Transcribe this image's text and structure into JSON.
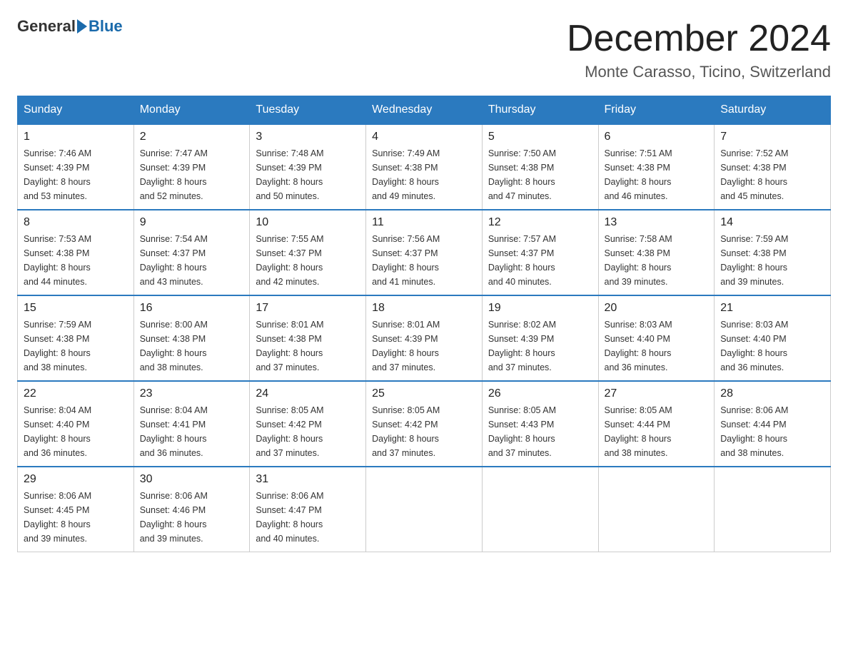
{
  "header": {
    "logo_general": "General",
    "logo_blue": "Blue",
    "month_title": "December 2024",
    "location": "Monte Carasso, Ticino, Switzerland"
  },
  "days_of_week": [
    "Sunday",
    "Monday",
    "Tuesday",
    "Wednesday",
    "Thursday",
    "Friday",
    "Saturday"
  ],
  "weeks": [
    [
      {
        "day": "1",
        "sunrise": "7:46 AM",
        "sunset": "4:39 PM",
        "daylight": "8 hours and 53 minutes."
      },
      {
        "day": "2",
        "sunrise": "7:47 AM",
        "sunset": "4:39 PM",
        "daylight": "8 hours and 52 minutes."
      },
      {
        "day": "3",
        "sunrise": "7:48 AM",
        "sunset": "4:39 PM",
        "daylight": "8 hours and 50 minutes."
      },
      {
        "day": "4",
        "sunrise": "7:49 AM",
        "sunset": "4:38 PM",
        "daylight": "8 hours and 49 minutes."
      },
      {
        "day": "5",
        "sunrise": "7:50 AM",
        "sunset": "4:38 PM",
        "daylight": "8 hours and 47 minutes."
      },
      {
        "day": "6",
        "sunrise": "7:51 AM",
        "sunset": "4:38 PM",
        "daylight": "8 hours and 46 minutes."
      },
      {
        "day": "7",
        "sunrise": "7:52 AM",
        "sunset": "4:38 PM",
        "daylight": "8 hours and 45 minutes."
      }
    ],
    [
      {
        "day": "8",
        "sunrise": "7:53 AM",
        "sunset": "4:38 PM",
        "daylight": "8 hours and 44 minutes."
      },
      {
        "day": "9",
        "sunrise": "7:54 AM",
        "sunset": "4:37 PM",
        "daylight": "8 hours and 43 minutes."
      },
      {
        "day": "10",
        "sunrise": "7:55 AM",
        "sunset": "4:37 PM",
        "daylight": "8 hours and 42 minutes."
      },
      {
        "day": "11",
        "sunrise": "7:56 AM",
        "sunset": "4:37 PM",
        "daylight": "8 hours and 41 minutes."
      },
      {
        "day": "12",
        "sunrise": "7:57 AM",
        "sunset": "4:37 PM",
        "daylight": "8 hours and 40 minutes."
      },
      {
        "day": "13",
        "sunrise": "7:58 AM",
        "sunset": "4:38 PM",
        "daylight": "8 hours and 39 minutes."
      },
      {
        "day": "14",
        "sunrise": "7:59 AM",
        "sunset": "4:38 PM",
        "daylight": "8 hours and 39 minutes."
      }
    ],
    [
      {
        "day": "15",
        "sunrise": "7:59 AM",
        "sunset": "4:38 PM",
        "daylight": "8 hours and 38 minutes."
      },
      {
        "day": "16",
        "sunrise": "8:00 AM",
        "sunset": "4:38 PM",
        "daylight": "8 hours and 38 minutes."
      },
      {
        "day": "17",
        "sunrise": "8:01 AM",
        "sunset": "4:38 PM",
        "daylight": "8 hours and 37 minutes."
      },
      {
        "day": "18",
        "sunrise": "8:01 AM",
        "sunset": "4:39 PM",
        "daylight": "8 hours and 37 minutes."
      },
      {
        "day": "19",
        "sunrise": "8:02 AM",
        "sunset": "4:39 PM",
        "daylight": "8 hours and 37 minutes."
      },
      {
        "day": "20",
        "sunrise": "8:03 AM",
        "sunset": "4:40 PM",
        "daylight": "8 hours and 36 minutes."
      },
      {
        "day": "21",
        "sunrise": "8:03 AM",
        "sunset": "4:40 PM",
        "daylight": "8 hours and 36 minutes."
      }
    ],
    [
      {
        "day": "22",
        "sunrise": "8:04 AM",
        "sunset": "4:40 PM",
        "daylight": "8 hours and 36 minutes."
      },
      {
        "day": "23",
        "sunrise": "8:04 AM",
        "sunset": "4:41 PM",
        "daylight": "8 hours and 36 minutes."
      },
      {
        "day": "24",
        "sunrise": "8:05 AM",
        "sunset": "4:42 PM",
        "daylight": "8 hours and 37 minutes."
      },
      {
        "day": "25",
        "sunrise": "8:05 AM",
        "sunset": "4:42 PM",
        "daylight": "8 hours and 37 minutes."
      },
      {
        "day": "26",
        "sunrise": "8:05 AM",
        "sunset": "4:43 PM",
        "daylight": "8 hours and 37 minutes."
      },
      {
        "day": "27",
        "sunrise": "8:05 AM",
        "sunset": "4:44 PM",
        "daylight": "8 hours and 38 minutes."
      },
      {
        "day": "28",
        "sunrise": "8:06 AM",
        "sunset": "4:44 PM",
        "daylight": "8 hours and 38 minutes."
      }
    ],
    [
      {
        "day": "29",
        "sunrise": "8:06 AM",
        "sunset": "4:45 PM",
        "daylight": "8 hours and 39 minutes."
      },
      {
        "day": "30",
        "sunrise": "8:06 AM",
        "sunset": "4:46 PM",
        "daylight": "8 hours and 39 minutes."
      },
      {
        "day": "31",
        "sunrise": "8:06 AM",
        "sunset": "4:47 PM",
        "daylight": "8 hours and 40 minutes."
      },
      null,
      null,
      null,
      null
    ]
  ],
  "labels": {
    "sunrise": "Sunrise:",
    "sunset": "Sunset:",
    "daylight": "Daylight:"
  }
}
